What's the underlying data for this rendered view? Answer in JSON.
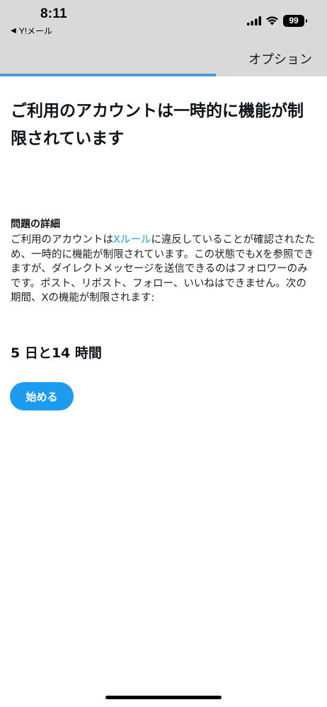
{
  "status_bar": {
    "time": "8:11",
    "back_app": "Y!メール",
    "back_caret": "◀",
    "battery_level": "99",
    "icons": [
      "signal-icon",
      "wifi-icon",
      "battery-icon"
    ]
  },
  "header": {
    "options_label": "オプション",
    "progress_fraction": 0.66,
    "progress_color": "#4a9bdc",
    "background_color": "#d9d9d9"
  },
  "main": {
    "title": "ご利用のアカウントは一時的に機能が制限されています",
    "details_heading": "問題の詳細",
    "details_text_before_link": "ご利用のアカウントは",
    "rules_link_text": "Xルール",
    "details_text_after_link": "に違反していることが確認されたため、一時的に機能が制限されています。この状態でもXを参照できますが、ダイレクトメッセージを送信できるのはフォロワーのみです。ポスト、リポスト、フォロー、いいねはできません。次の期間、Xの機能が制限されます:",
    "duration": "5 日と14 時間",
    "start_button_label": "始める",
    "accent_color": "#1d9bf0"
  }
}
